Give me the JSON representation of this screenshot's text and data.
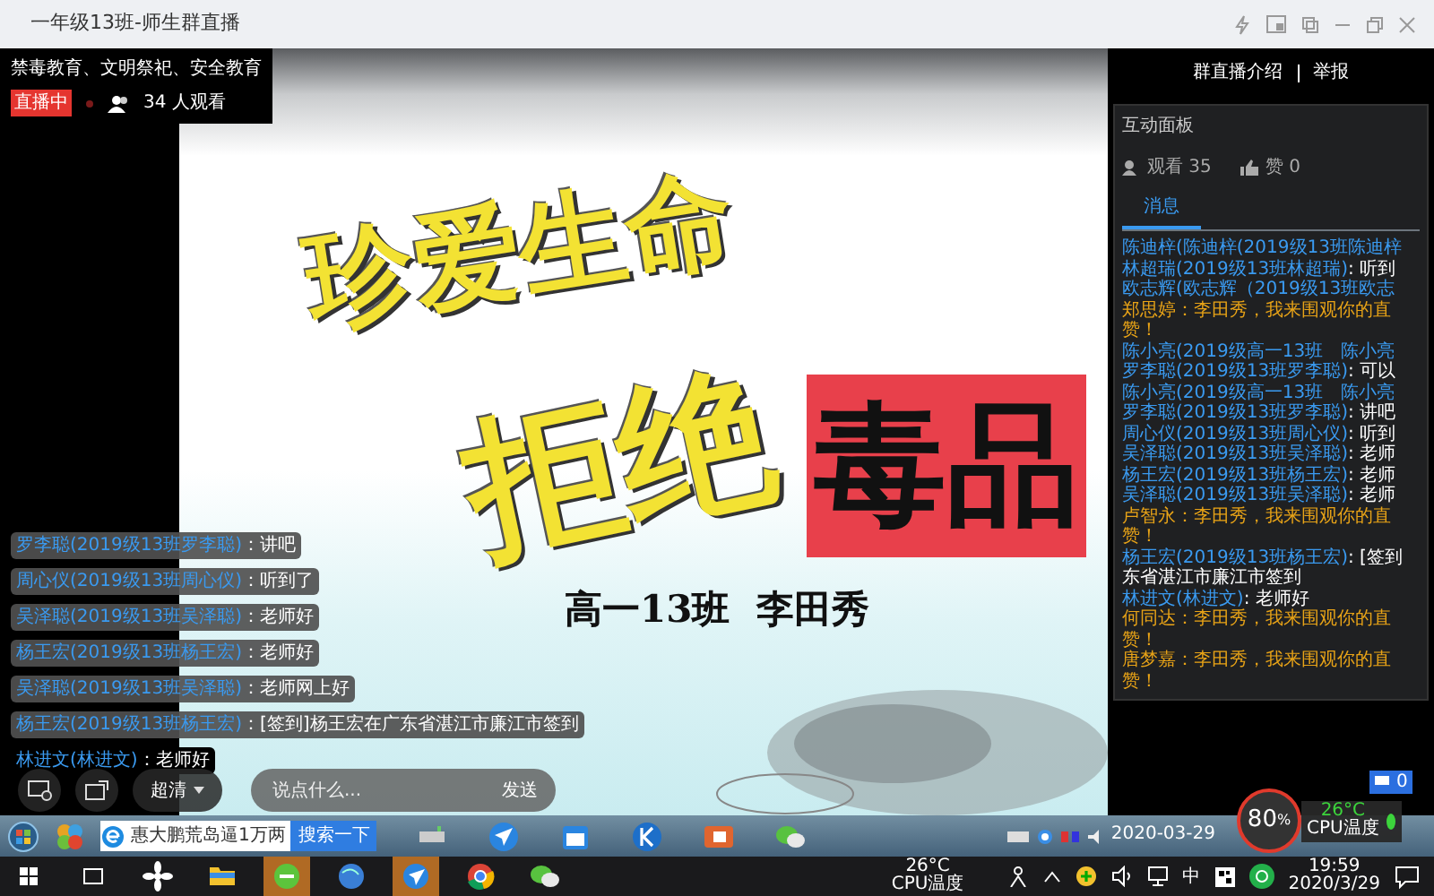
{
  "window": {
    "title": "一年级13班-师生群直播"
  },
  "stream": {
    "topic": "禁毒教育、文明祭祀、安全教育",
    "live_badge": "直播中",
    "live": true,
    "viewers": "34 人观看"
  },
  "slide": {
    "line_1": "珍爱生命",
    "line_2": "拒绝",
    "stamp": "毒品",
    "caption": "高一13班  李田秀"
  },
  "chat_overlay": [
    {
      "sender": "罗李聪(2019级13班罗李聪)",
      "text": "：讲吧"
    },
    {
      "sender": "周心仪(2019级13班周心仪)",
      "text": "：听到了"
    },
    {
      "sender": "吴泽聪(2019级13班吴泽聪)",
      "text": "：老师好"
    },
    {
      "sender": "杨王宏(2019级13班杨王宏)",
      "text": "：老师好"
    },
    {
      "sender": "吴泽聪(2019级13班吴泽聪)",
      "text": "：老师网上好"
    },
    {
      "sender": "杨王宏(2019级13班杨王宏)",
      "text": "：[签到]杨王宏在广东省湛江市廉江市签到"
    },
    {
      "sender": "林进文(林进文)",
      "text": "：老师好"
    }
  ],
  "controls": {
    "quality": "超清",
    "placeholder": "说点什么...",
    "send": "发送"
  },
  "right_panel": {
    "links": [
      "群直播介绍",
      "举报"
    ],
    "panel_title": "互动面板",
    "views": "观看 35",
    "likes": "赞 0",
    "tabs": [
      {
        "label": "消息",
        "selected": true
      }
    ],
    "messages": [
      {
        "kind": "user",
        "sender": "陈迪梓(陈迪梓(2019级13班陈迪梓"
      },
      {
        "kind": "user",
        "sender": "林超瑞(2019级13班林超瑞)",
        "text": ": 听到"
      },
      {
        "kind": "user",
        "sender": "欧志辉(欧志辉（2019级13班欧志"
      },
      {
        "kind": "visitor",
        "text": "郑思婷：李田秀，我来围观你的直",
        "continuation": "赞！"
      },
      {
        "kind": "user",
        "sender": "陈小亮(2019级高一13班　陈小亮"
      },
      {
        "kind": "user",
        "sender": "罗李聪(2019级13班罗李聪)",
        "text": ": 可以"
      },
      {
        "kind": "user",
        "sender": "陈小亮(2019级高一13班　陈小亮"
      },
      {
        "kind": "user",
        "sender": "罗李聪(2019级13班罗李聪)",
        "text": ": 讲吧"
      },
      {
        "kind": "user",
        "sender": "周心仪(2019级13班周心仪)",
        "text": ": 听到"
      },
      {
        "kind": "user",
        "sender": "吴泽聪(2019级13班吴泽聪)",
        "text": ": 老师"
      },
      {
        "kind": "user",
        "sender": "杨王宏(2019级13班杨王宏)",
        "text": ": 老师"
      },
      {
        "kind": "user",
        "sender": "吴泽聪(2019级13班吴泽聪)",
        "text": ": 老师"
      },
      {
        "kind": "visitor",
        "text": "卢智永：李田秀，我来围观你的直",
        "continuation": "赞！"
      },
      {
        "kind": "user",
        "sender": "杨王宏(2019级13班杨王宏)",
        "text": ": [签到",
        "continuation": "东省湛江市廉江市签到"
      },
      {
        "kind": "user",
        "sender": "林进文(林进文)",
        "text": ": 老师好"
      },
      {
        "kind": "visitor",
        "text": "何同达：李田秀，我来围观你的直",
        "continuation": "赞！"
      },
      {
        "kind": "visitor",
        "text": "唐梦嘉：李田秀，我来围观你的直",
        "continuation": "赞！"
      }
    ]
  },
  "inner_taskbar": {
    "search_text": "惠大鹏荒岛逼1万两",
    "search_button": "搜索一下",
    "date": "2020-03-29"
  },
  "cpu_widget": {
    "usage": "80",
    "unit": "%",
    "temp": "26°C",
    "label": "CPU温度",
    "badge": "0"
  },
  "taskbar": {
    "temp": "26°C",
    "temp_label": "CPU温度",
    "ime": "中",
    "time": "19:59",
    "date": "2020/3/29"
  }
}
